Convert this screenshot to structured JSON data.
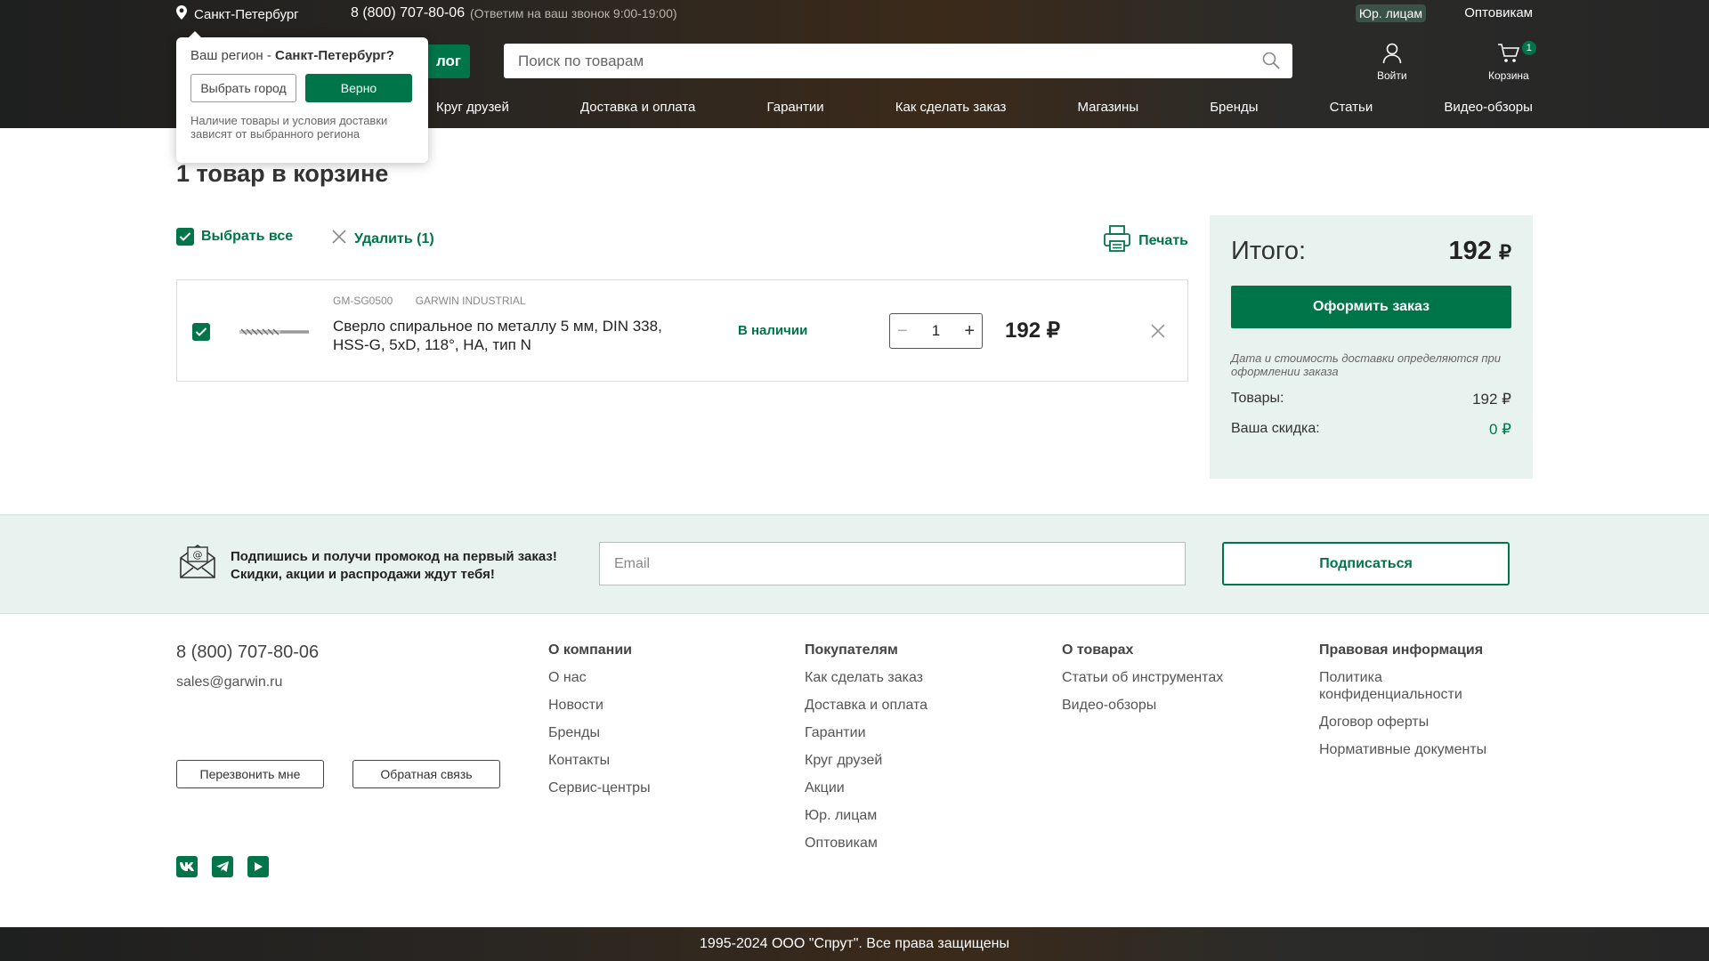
{
  "topbar": {
    "city": "Санкт-Петербург",
    "phone": "8 (800) 707-80-06",
    "phone_note": "(Ответим на ваш звонок 9:00-19:00)",
    "legal": "Юр. лицам",
    "wholesale": "Оптовикам"
  },
  "header": {
    "catalog_label": "лог",
    "search_placeholder": "Поиск по товарам",
    "login_label": "Войти",
    "cart_label": "Корзина",
    "cart_count": "1"
  },
  "nav": [
    "Круг друзей",
    "Доставка и оплата",
    "Гарантии",
    "Как сделать заказ",
    "Магазины",
    "Бренды",
    "Статьи",
    "Видео-обзоры"
  ],
  "region_popup": {
    "question_prefix": "Ваш регион - ",
    "question_city": "Санкт-Петербург?",
    "choose_label": "Выбрать город",
    "ok_label": "Верно",
    "note": "Наличие товары и условия доставки зависят от выбранного региона"
  },
  "cart": {
    "title": "1 товар в корзине",
    "select_all": "Выбрать все",
    "delete_selected": "Удалить (1)",
    "print": "Печать",
    "items": [
      {
        "sku": "GM-SG0500",
        "brand": "GARWIN INDUSTRIAL",
        "name": "Сверло спиральное по металлу 5 мм, DIN 338, HSS-G, 5xD, 118°, HA, тип N",
        "stock": "В наличии",
        "qty": "1",
        "price": "192 ₽"
      }
    ]
  },
  "summary": {
    "total_label": "Итого:",
    "total_value": "192",
    "currency": "₽",
    "order_button": "Оформить заказ",
    "note": "Дата и стоимость доставки определяются при оформлении заказа",
    "goods_label": "Товары:",
    "goods_value": "192 ₽",
    "discount_label": "Ваша скидка:",
    "discount_value": "0 ₽"
  },
  "subscribe": {
    "text_line1": "Подпишись и получи промокод на первый заказ!",
    "text_line2": "Скидки, акции и распродажи ждут тебя!",
    "email_placeholder": "Email",
    "button": "Подписаться"
  },
  "footer": {
    "phone": "8 (800) 707-80-06",
    "email": "sales@garwin.ru",
    "callback_button": "Перезвонить мне",
    "feedback_button": "Обратная связь",
    "columns": [
      {
        "title": "О компании",
        "links": [
          "О нас",
          "Новости",
          "Бренды",
          "Контакты",
          "Сервис-центры"
        ]
      },
      {
        "title": "Покупателям",
        "links": [
          "Как сделать заказ",
          "Доставка и оплата",
          "Гарантии",
          "Круг друзей",
          "Акции",
          "Юр. лицам",
          "Оптовикам"
        ]
      },
      {
        "title": "О товарах",
        "links": [
          "Статьи об инструментах",
          "Видео-обзоры"
        ]
      },
      {
        "title": "Правовая информация",
        "links": [
          "Политика конфиденциальности",
          "Договор оферты",
          "Нормативные документы"
        ]
      }
    ],
    "copyright": "1995-2024 ООО \"Спрут\". Все права защищены"
  },
  "colors": {
    "accent": "#00754a",
    "summary_bg": "#e8f3f0"
  }
}
